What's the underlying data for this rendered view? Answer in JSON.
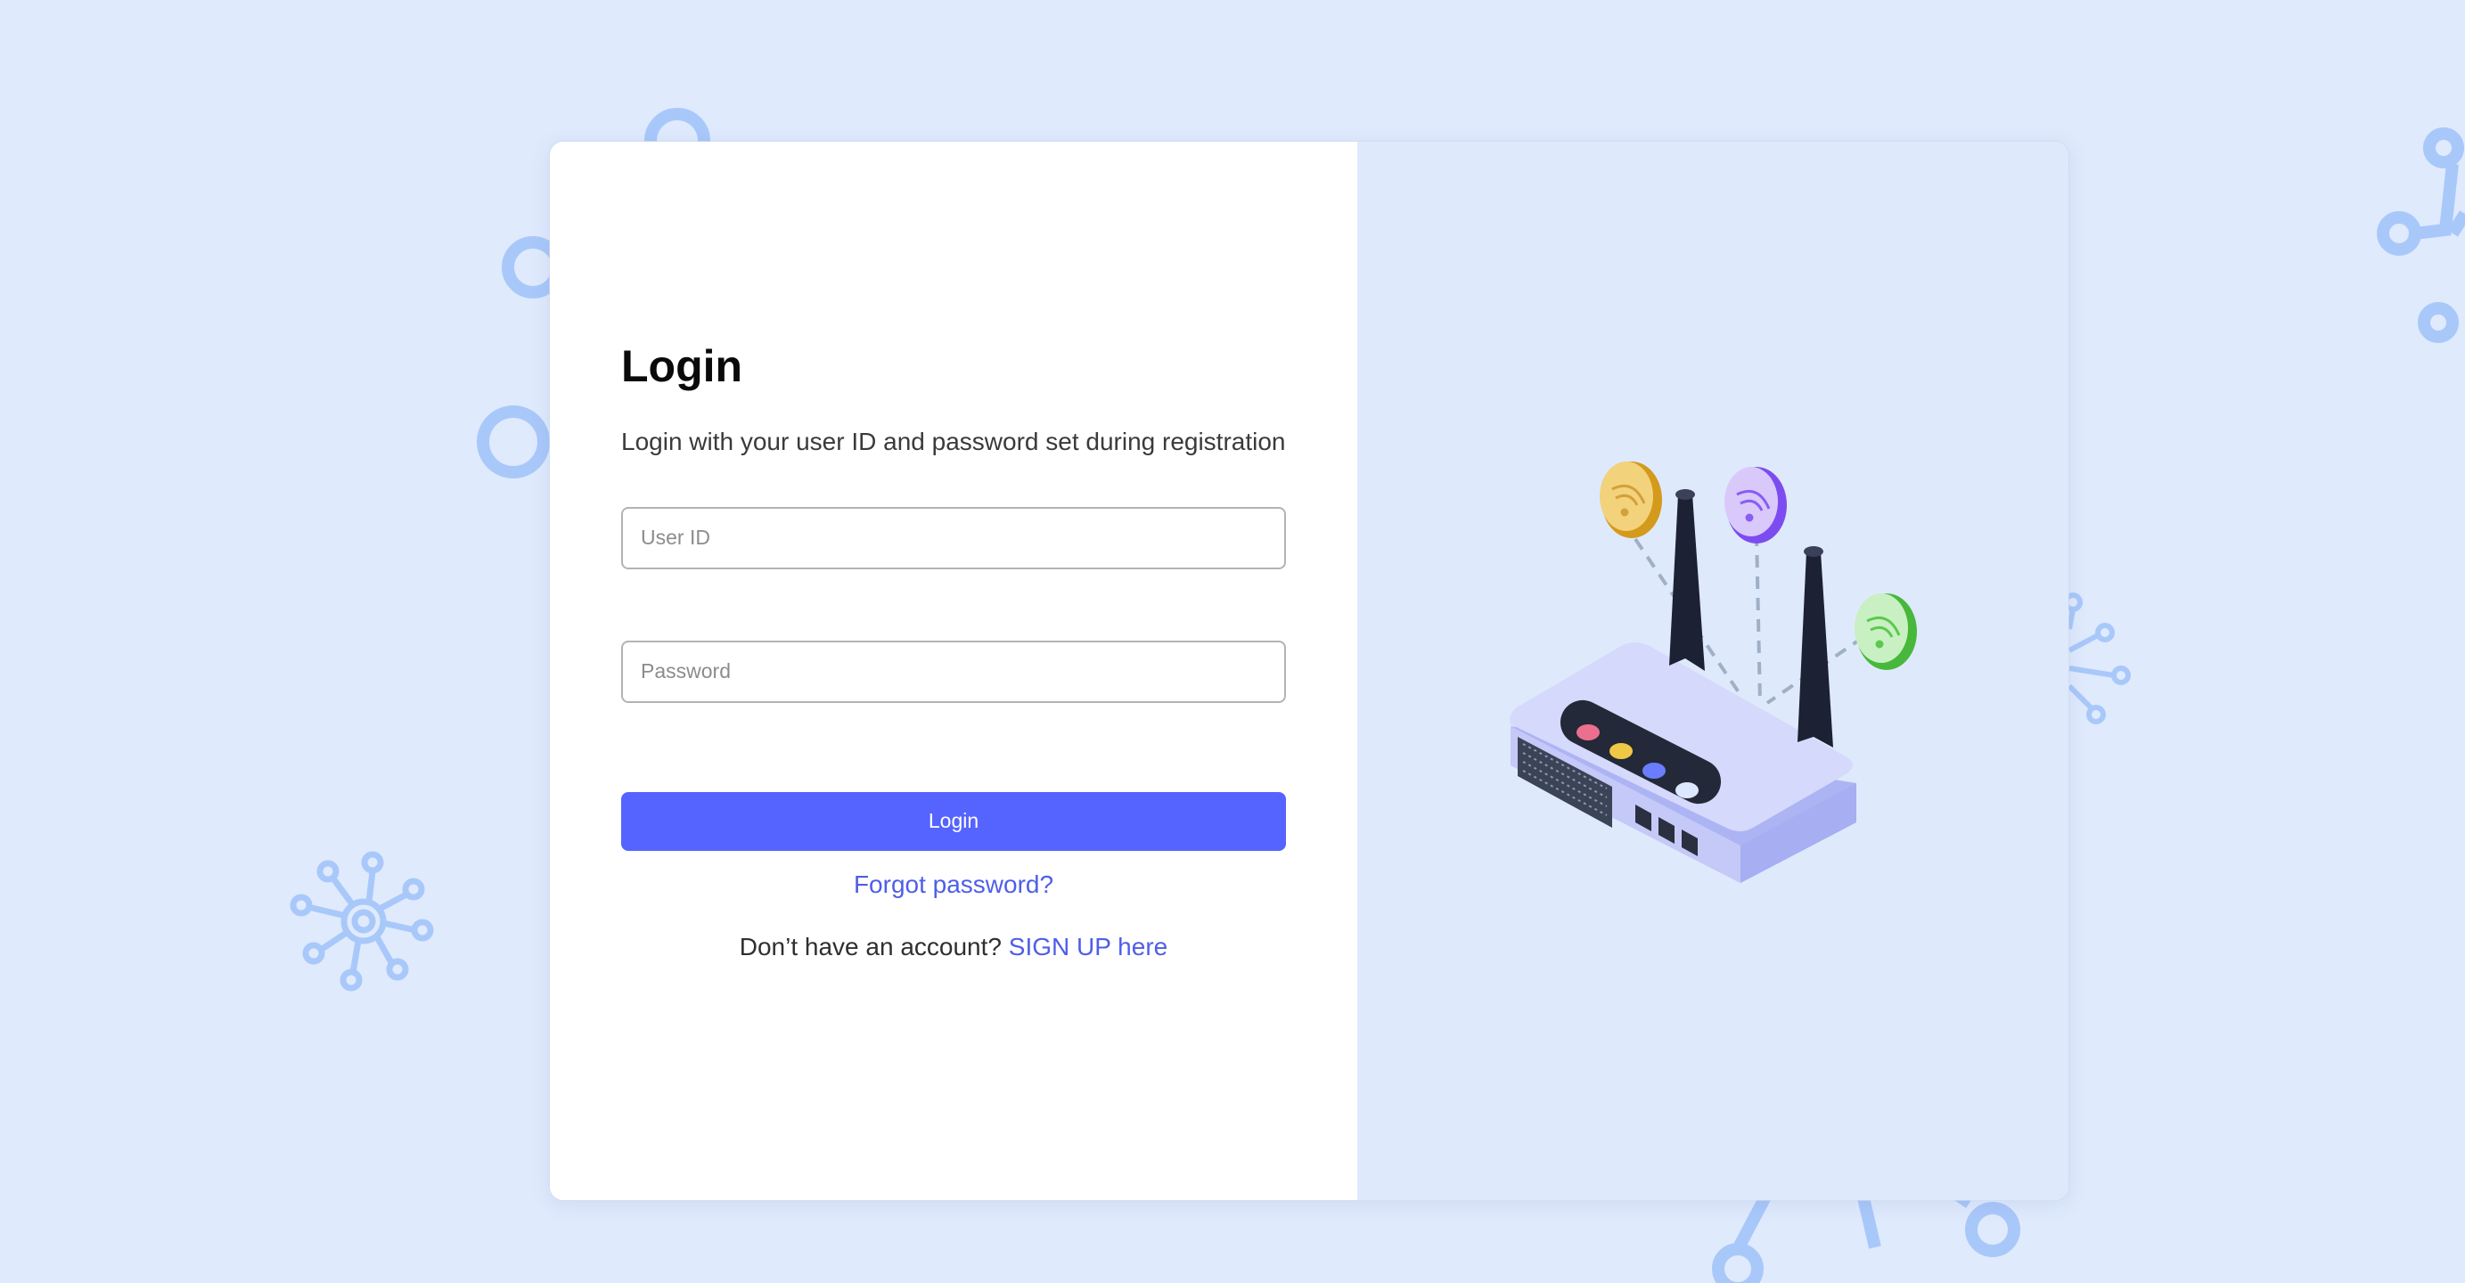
{
  "login": {
    "title": "Login",
    "subtitle": "Login with your user ID and password set during registration",
    "user_id_placeholder": "User ID",
    "password_placeholder": "Password",
    "submit_label": "Login",
    "forgot_label": "Forgot password?",
    "no_account_text": "Don’t have an account?",
    "signup_label": "SIGN UP here"
  },
  "colors": {
    "page_background": "#dfeafd",
    "illustration_panel": "#deeafc",
    "primary_button": "#5563ff",
    "link": "#4f5ee8",
    "decoration": "#a9c8fa"
  },
  "illustration": {
    "subject": "wifi-router",
    "signal_badge_colors": [
      "#e2b52a",
      "#8a5cf6",
      "#5bc94e"
    ],
    "status_led_colors": [
      "#ec6f8e",
      "#f0c846",
      "#6a7dff",
      "#dbe8ff"
    ]
  }
}
